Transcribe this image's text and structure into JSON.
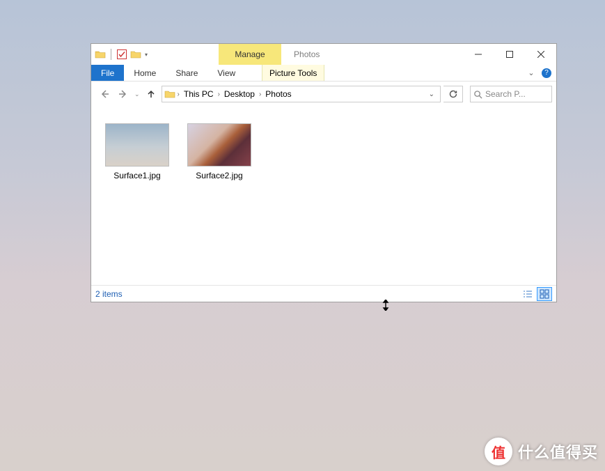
{
  "titlebar": {
    "context_label": "Manage",
    "context_sublabel": "Picture Tools",
    "window_title": "Photos"
  },
  "ribbon": {
    "file_label": "File",
    "tabs": [
      "Home",
      "Share",
      "View"
    ]
  },
  "breadcrumb": {
    "segments": [
      "This PC",
      "Desktop",
      "Photos"
    ]
  },
  "search": {
    "placeholder": "Search P..."
  },
  "files": [
    {
      "name": "Surface1.jpg"
    },
    {
      "name": "Surface2.jpg"
    }
  ],
  "status": {
    "text": "2 items"
  },
  "watermark": {
    "badge": "值",
    "text": "什么值得买"
  }
}
